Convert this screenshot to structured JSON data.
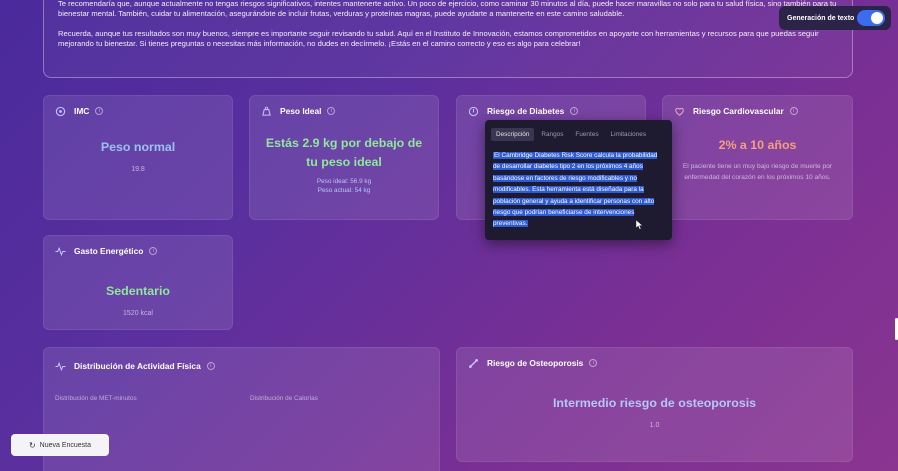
{
  "intro": {
    "paragraph1": "Te recomendaría que, aunque actualmente no tengas riesgos significativos, intentes mantenerte activo. Un poco de ejercicio, como caminar 30 minutos al día, puede hacer maravillas no solo para tu salud física, sino también para tu bienestar mental. También, cuidar tu alimentación, asegurándote de incluir frutas, verduras y proteínas magras, puede ayudarte a mantenerte en este camino saludable.",
    "paragraph2": "Recuerda, aunque tus resultados son muy buenos, siempre es importante seguir revisando tu salud. Aquí en el Instituto de Innovación, estamos comprometidos en apoyarte con herramientas y recursos para que puedas seguir mejorando tu bienestar. Si tienes preguntas o necesitas más información, no dudes en decírmelo. ¡Estás en el camino correcto y eso es algo para celebrar!"
  },
  "toggle": {
    "label": "Generación de texto",
    "on": true
  },
  "cards": {
    "imc": {
      "title": "IMC",
      "value": "Peso normal",
      "sub": "19.8",
      "icon": "scale-icon"
    },
    "peso": {
      "title": "Peso Ideal",
      "value": "Estás 2.9 kg por debajo de tu peso ideal",
      "line1": "Peso ideal: 56.9 kg",
      "line2": "Peso actual: 54 kg",
      "icon": "weight-icon"
    },
    "diabetes": {
      "title": "Riesgo de Diabetes",
      "icon": "drop-icon"
    },
    "cardio": {
      "title": "Riesgo Cardiovascular",
      "value": "2% a 10 años",
      "sub": "El paciente tiene un muy bajo riesgo de muerte por enfermedad del corazón en los próximos 10 años.",
      "icon": "heart-icon"
    },
    "gasto": {
      "title": "Gasto Energético",
      "value": "Sedentario",
      "sub": "1520 kcal",
      "icon": "pulse-icon"
    },
    "actividad": {
      "title": "Distribución de Actividad Física",
      "col1": "Distribución de MET-minutos",
      "col2": "Distribución de Calorías",
      "icon": "activity-icon"
    },
    "osteo": {
      "title": "Riesgo de Osteoporosis",
      "value": "Intermedio riesgo de osteoporosis",
      "sub": "1.0",
      "icon": "bone-icon"
    }
  },
  "tooltip": {
    "tabs": [
      "Descripción",
      "Rangos",
      "Fuentes",
      "Limitaciones"
    ],
    "active_tab": "Descripción",
    "text": "El Cambridge Diabetes Risk Score calcula la probabilidad de desarrollar diabetes tipo 2 en los próximos 4 años basándose en factores de riesgo modificables y no modificables. Esta herramienta está diseñada para la población general y ayuda a identificar personas con alto riesgo que podrían beneficiarse de intervenciones preventivas."
  },
  "new_poll": {
    "label": "Nueva Encuesta",
    "icon": "refresh-icon"
  },
  "colors": {
    "accent": "#3b6cf0",
    "normal": "#9bc2f2",
    "good": "#8fe89b",
    "warn": "#f4a07c"
  }
}
